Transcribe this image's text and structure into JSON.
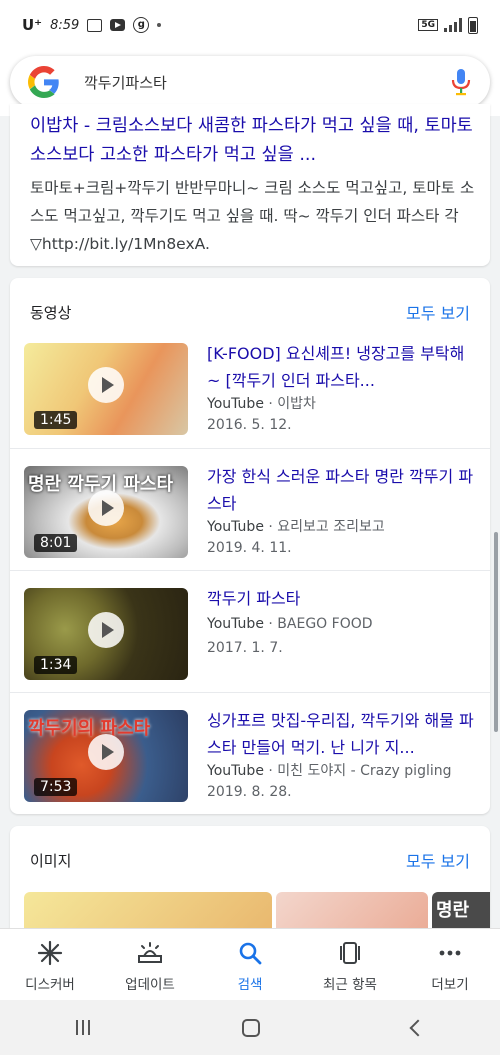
{
  "status": {
    "carrier": "U⁺",
    "time": "8:59",
    "network": "5G",
    "icons": [
      "gallery-icon",
      "youtube-icon",
      "g-circle-icon",
      "dot-icon",
      "signal-icon",
      "battery-icon"
    ]
  },
  "search": {
    "query": "깍두기파스타",
    "logo": "google-g-icon",
    "mic": "mic-icon"
  },
  "result": {
    "title": "이밥차 - 크림소스보다 새콤한 파스타가 먹고 싶을 때, 토마토소스보다 고소한 파스타가 먹고 싶을 ...",
    "snippet": "토마토+크림+깍두기 반반무마니~ 크림 소스도 먹고싶고, 토마토 소스도 먹고싶고, 깍두기도 먹고 싶을 때. 딱~ 깍두기 인더 파스타 각 ▽http://bit.ly/1Mn8exA."
  },
  "videos": {
    "heading": "동영상",
    "more": "모두 보기",
    "items": [
      {
        "title": "[K-FOOD] 요신셰프! 냉장고를 부탁해~ [깍두기 인더 파스타...",
        "platform": "YouTube",
        "channel": "이밥차",
        "date": "2016. 5. 12.",
        "duration": "1:45",
        "thumb_text": ""
      },
      {
        "title": "가장 한식 스러운 파스타 명란 깍뚜기 파스타",
        "platform": "YouTube",
        "channel": "요리보고 조리보고",
        "date": "2019. 4. 11.",
        "duration": "8:01",
        "thumb_text": "명란 깍두기 파스타"
      },
      {
        "title": "깍두기 파스타",
        "platform": "YouTube",
        "channel": "BAEGO FOOD",
        "date": "2017. 1. 7.",
        "duration": "1:34",
        "thumb_text": ""
      },
      {
        "title": "싱가포르 맛집-우리집, 깍두기와 해물 파스타 만들어 먹기. 난 니가 지...",
        "platform": "YouTube",
        "channel": "미친 도야지 - Crazy pigling",
        "date": "2019. 8. 28.",
        "duration": "7:53",
        "thumb_text": "깍두기의 파스타"
      }
    ]
  },
  "images": {
    "heading": "이미지",
    "more": "모두 보기",
    "peek_text": "명란"
  },
  "nav": [
    {
      "label": "디스커버",
      "icon": "asterisk-icon"
    },
    {
      "label": "업데이트",
      "icon": "updates-icon"
    },
    {
      "label": "검색",
      "icon": "search-icon"
    },
    {
      "label": "최근 항목",
      "icon": "recent-icon"
    },
    {
      "label": "더보기",
      "icon": "more-icon"
    }
  ],
  "colors": {
    "link": "#1a0dab",
    "accent": "#1a73e8"
  }
}
